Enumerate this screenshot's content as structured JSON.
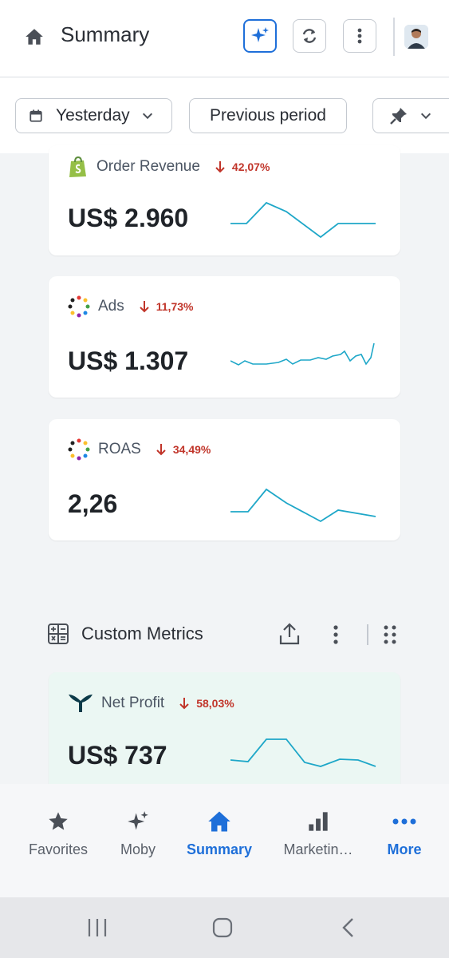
{
  "header": {
    "title": "Summary"
  },
  "filters": {
    "date_range": "Yesterday",
    "compare": "Previous period"
  },
  "cards": [
    {
      "label": "Order Revenue",
      "delta": "42,07%",
      "value": "US$ 2.960",
      "icon": "shopify-icon"
    },
    {
      "label": "Ads",
      "delta": "11,73%",
      "value": "US$ 1.307",
      "icon": "dots-circle-icon"
    },
    {
      "label": "ROAS",
      "delta": "34,49%",
      "value": "2,26",
      "icon": "dots-circle-icon"
    },
    {
      "label": "Net Profit",
      "delta": "58,03%",
      "value": "US$ 737",
      "icon": "triple-whale-icon"
    }
  ],
  "custom_metrics": {
    "title": "Custom Metrics"
  },
  "bottom_nav": [
    {
      "label": "Favorites",
      "icon": "star-icon"
    },
    {
      "label": "Moby",
      "icon": "sparkles-icon"
    },
    {
      "label": "Summary",
      "icon": "home-icon"
    },
    {
      "label": "Marketin…",
      "icon": "bar-chart-icon"
    },
    {
      "label": "More",
      "icon": "more-dots-icon"
    }
  ],
  "colors": {
    "accent": "#1e6fd9",
    "negative": "#c1352a",
    "spark_line": "#1ea7c8",
    "net_profit_bg": "#ebf7f3"
  }
}
